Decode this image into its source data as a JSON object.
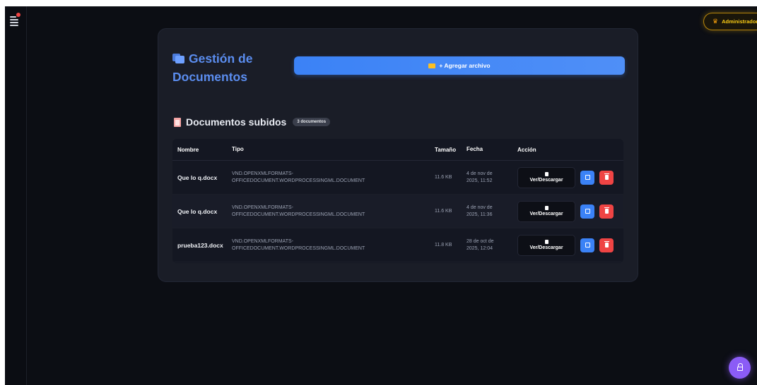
{
  "header": {
    "admin_badge": "Administrador",
    "crown_glyph": "♛"
  },
  "card": {
    "title": "Gestión de Documentos",
    "add_button": "+ Agregar archivo"
  },
  "section": {
    "title": "Documentos subidos",
    "count_badge": "3 documentos"
  },
  "table": {
    "headers": {
      "name": "Nombre",
      "type": "Tipo",
      "size": "Tamaño",
      "date": "Fecha",
      "action": "Acción"
    },
    "rows": [
      {
        "name": "Que lo q.docx",
        "type_line1": "VND.OPENXMLFORMATS-",
        "type_line2": "OFFICEDOCUMENT.WORDPROCESSINGML.DOCUMENT",
        "size": "11.6 KB",
        "date_line1": "4 de nov de",
        "date_line2": "2025, 11:52",
        "view_label": "Ver/Descargar"
      },
      {
        "name": "Que lo q.docx",
        "type_line1": "VND.OPENXMLFORMATS-",
        "type_line2": "OFFICEDOCUMENT.WORDPROCESSINGML.DOCUMENT",
        "size": "11.6 KB",
        "date_line1": "4 de nov de",
        "date_line2": "2025, 11:36",
        "view_label": "Ver/Descargar"
      },
      {
        "name": "prueba123.docx",
        "type_line1": "VND.OPENXMLFORMATS-",
        "type_line2": "OFFICEDOCUMENT.WORDPROCESSINGML.DOCUMENT",
        "size": "11.8 KB",
        "date_line1": "28 de oct de",
        "date_line2": "2025, 12:04",
        "view_label": "Ver/Descargar"
      }
    ]
  },
  "colors": {
    "accent": "#3b82f6",
    "title": "#5b8def",
    "danger": "#ef4444",
    "admin": "#facc15",
    "fab": "#8b5cf6"
  }
}
